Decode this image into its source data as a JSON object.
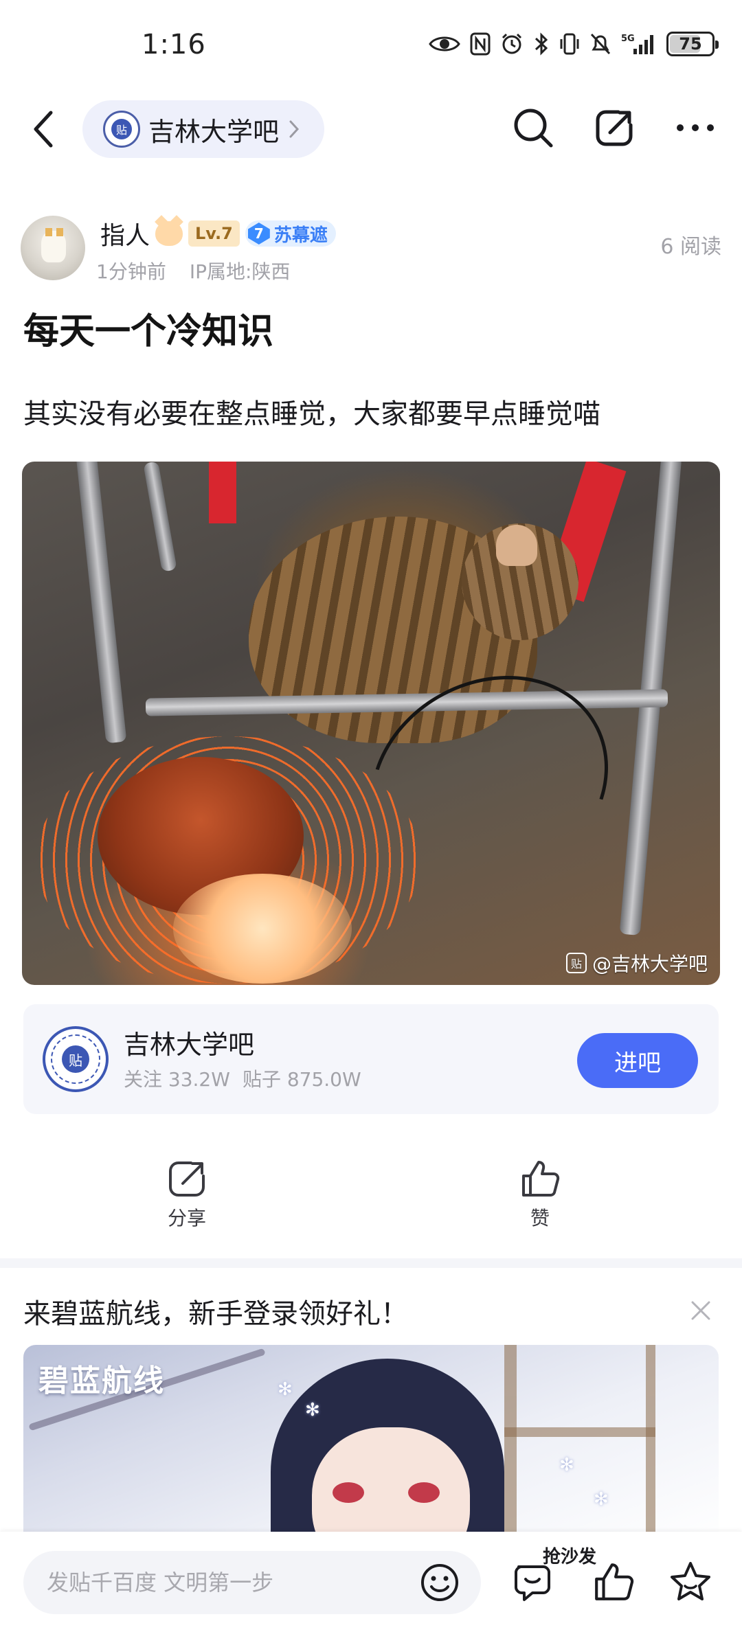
{
  "status_bar": {
    "time": "1:16",
    "network_label": "5G",
    "battery_percent": "75"
  },
  "nav": {
    "forum_name": "吉林大学吧",
    "forum_logo_char": "贴"
  },
  "post": {
    "author": {
      "name": "指人",
      "level": "Lv.7",
      "member_level": "7",
      "member_name": "苏幕遮",
      "time_ago": "1分钟前",
      "ip_location": "IP属地:陕西"
    },
    "read_count": "6 阅读",
    "title": "每天一个冷知识",
    "body": "其实没有必要在整点睡觉，大家都要早点睡觉喵",
    "image_watermark": "@吉林大学吧",
    "watermark_logo_char": "贴"
  },
  "forum_card": {
    "name": "吉林大学吧",
    "logo_char": "贴",
    "followers": "关注 33.2W",
    "posts": "贴子 875.0W",
    "join_label": "进吧"
  },
  "actions": {
    "share_label": "分享",
    "like_label": "赞"
  },
  "ad": {
    "title": "来碧蓝航线，新手登录领好礼！",
    "brand_text": "碧蓝航线"
  },
  "bottom_bar": {
    "comment_placeholder": "发贴千百度 文明第一步",
    "sofa_label": "抢沙发"
  },
  "colors": {
    "accent_blue": "#4a6cf7",
    "pill_bg": "#eef0fb",
    "level_badge_bg": "#fbe7c4",
    "member_blue": "#3a8cff"
  }
}
